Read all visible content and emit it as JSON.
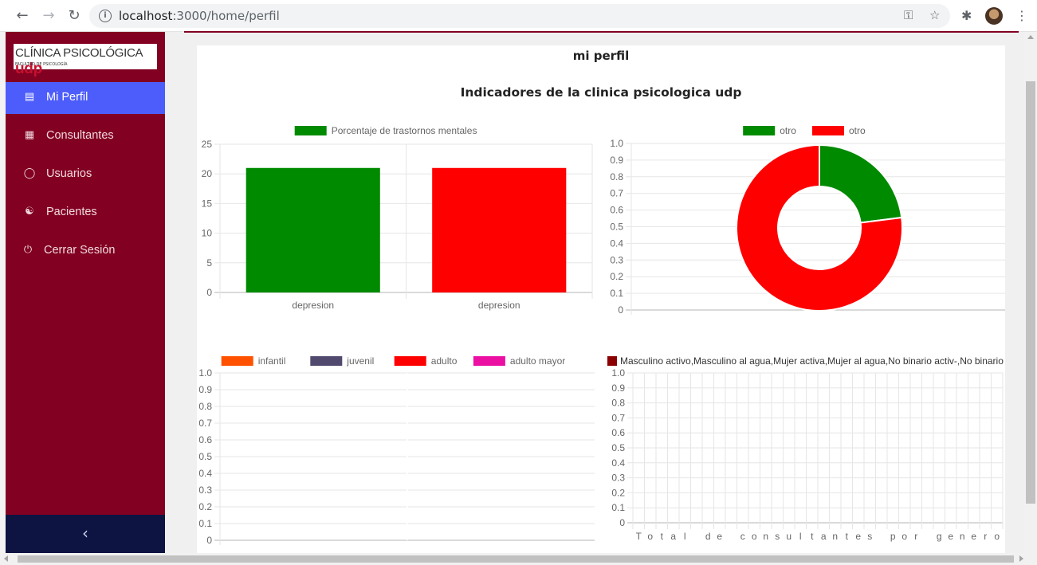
{
  "browser": {
    "url_host": "localhost",
    "url_path": ":3000/home/perfil",
    "icons": [
      "back-icon",
      "forward-icon",
      "reload-icon",
      "info-icon",
      "key-icon",
      "star-icon",
      "extensions-icon",
      "menu-icon"
    ]
  },
  "sidebar": {
    "logo": {
      "text": "CLÍNICA PSICOLÓGICA",
      "brand": "udp",
      "subtitle": "FACULTAD DE PSICOLOGÍA"
    },
    "items": [
      {
        "label": "Mi Perfil",
        "icon": "id-card-icon",
        "active": true
      },
      {
        "label": "Consultantes",
        "icon": "document-icon",
        "active": false
      },
      {
        "label": "Usuarios",
        "icon": "user-icon",
        "active": false
      },
      {
        "label": "Pacientes",
        "icon": "users-icon",
        "active": false
      },
      {
        "label": "Cerrar Sesión",
        "icon": "power-icon",
        "active": false
      }
    ],
    "collapse_label": "‹",
    "colors": {
      "background": "#820022",
      "active": "#4d5dfb",
      "footer": "#0d1442"
    }
  },
  "main": {
    "title": "mi perfil",
    "subtitle": "Indicadores de la clinica psicologica udp"
  },
  "chart_data": [
    {
      "type": "bar",
      "legend": [
        {
          "label": "Porcentaje de trastornos mentales",
          "color": "#008a00"
        }
      ],
      "categories": [
        "depresion",
        "depresion"
      ],
      "values": [
        21,
        21
      ],
      "colors": [
        "#008a00",
        "#ff0000"
      ],
      "ylim": [
        0,
        25
      ],
      "yticks": [
        "0",
        "5",
        "10",
        "15",
        "20",
        "25"
      ]
    },
    {
      "type": "pie",
      "variant": "doughnut",
      "legend": [
        {
          "label": "otro",
          "color": "#008a00"
        },
        {
          "label": "otro",
          "color": "#ff0000"
        }
      ],
      "values": [
        23,
        77
      ],
      "colors": [
        "#008a00",
        "#ff0000"
      ],
      "ylim": [
        0,
        1
      ],
      "yticks": [
        "0",
        "0.1",
        "0.2",
        "0.3",
        "0.4",
        "0.5",
        "0.6",
        "0.7",
        "0.8",
        "0.9",
        "1.0"
      ]
    },
    {
      "type": "bar",
      "legend": [
        {
          "label": "infantil",
          "color": "#ff5100"
        },
        {
          "label": "juvenil",
          "color": "#524a6e"
        },
        {
          "label": "adulto",
          "color": "#ff0000"
        },
        {
          "label": "adulto mayor",
          "color": "#eb10a2"
        }
      ],
      "values": [],
      "ylim": [
        0,
        1
      ],
      "yticks": [
        "0",
        "0.1",
        "0.2",
        "0.3",
        "0.4",
        "0.5",
        "0.6",
        "0.7",
        "0.8",
        "0.9",
        "1.0"
      ]
    },
    {
      "type": "bar",
      "legend": [
        {
          "label": "Masculino activo,Masculino al agua,Mujer activa,Mujer al agua,No binario activ-,No binario",
          "color": "#8b0000"
        }
      ],
      "x_label_chars": [
        "T",
        "o",
        "t",
        "a",
        "l",
        "d",
        "e",
        "c",
        "o",
        "n",
        "s",
        "u",
        "l",
        "t",
        "a",
        "n",
        "t",
        "e",
        "s",
        "p",
        "o",
        "r",
        "g",
        "e",
        "n",
        "e",
        "r",
        "o"
      ],
      "values": [],
      "ylim": [
        0,
        1
      ],
      "yticks": [
        "0",
        "0.1",
        "0.2",
        "0.3",
        "0.4",
        "0.5",
        "0.6",
        "0.7",
        "0.8",
        "0.9",
        "1.0"
      ]
    }
  ]
}
